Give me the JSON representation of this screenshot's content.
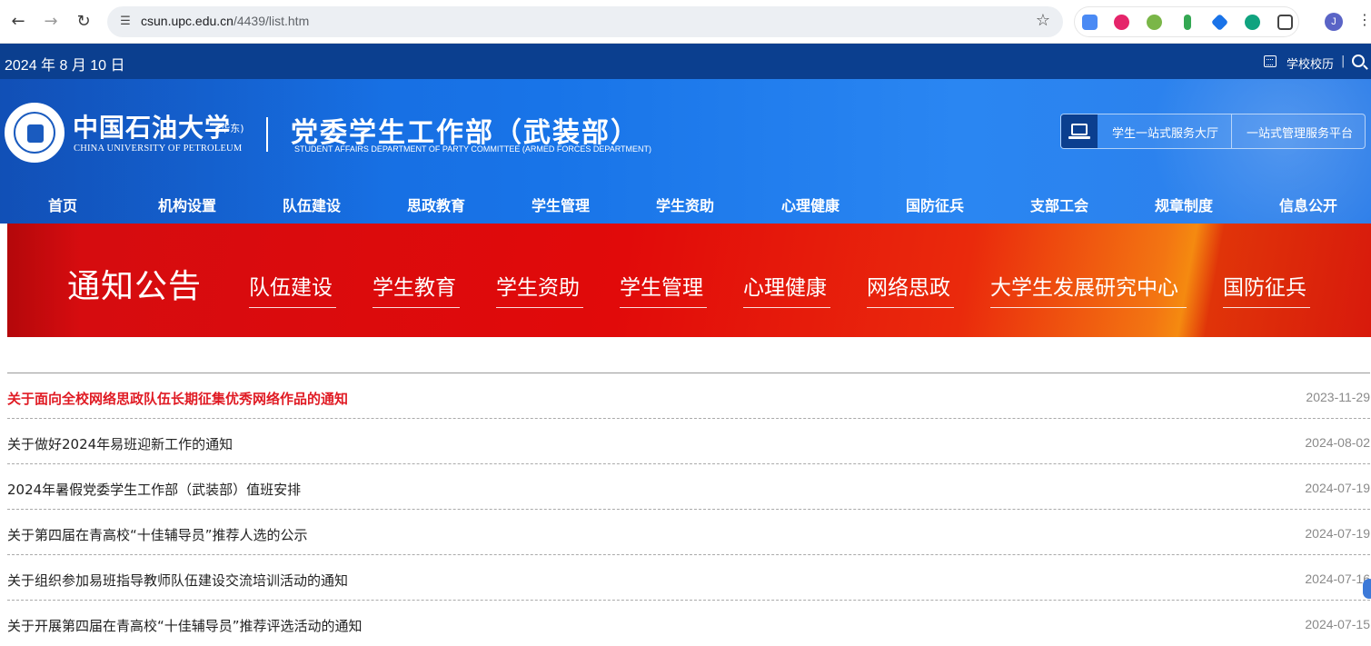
{
  "browser": {
    "url_host": "csun.upc.edu.cn",
    "url_path": "/4439/list.htm",
    "profile_initial": "J"
  },
  "topbar": {
    "date": "2024 年 8 月 10 日",
    "calendar_link": "学校校历",
    "separator": "|"
  },
  "header": {
    "university_cn": "中国石油大学",
    "university_sub": "(华东)",
    "university_en": "CHINA UNIVERSITY OF PETROLEUM",
    "department_cn": "党委学生工作部（武装部）",
    "department_en": "STUDENT AFFAIRS DEPARTMENT OF PARTY COMMITTEE (ARMED FORCES DEPARTMENT)",
    "service_links": [
      "学生一站式服务大厅",
      "一站式管理服务平台"
    ]
  },
  "main_nav": [
    "首页",
    "机构设置",
    "队伍建设",
    "思政教育",
    "学生管理",
    "学生资助",
    "心理健康",
    "国防征兵",
    "支部工会",
    "规章制度",
    "信息公开"
  ],
  "banner": {
    "title": "通知公告",
    "tabs": [
      "队伍建设",
      "学生教育",
      "学生资助",
      "学生管理",
      "心理健康",
      "网络思政",
      "大学生发展研究中心",
      "国防征兵"
    ]
  },
  "notices": [
    {
      "title": "关于面向全校网络思政队伍长期征集优秀网络作品的通知",
      "date": "2023-11-29",
      "pinned": true
    },
    {
      "title": "关于做好2024年易班迎新工作的通知",
      "date": "2024-08-02",
      "pinned": false
    },
    {
      "title": "2024年暑假党委学生工作部（武装部）值班安排",
      "date": "2024-07-19",
      "pinned": false
    },
    {
      "title": "关于第四届在青高校“十佳辅导员”推荐人选的公示",
      "date": "2024-07-19",
      "pinned": false
    },
    {
      "title": "关于组织参加易班指导教师队伍建设交流培训活动的通知",
      "date": "2024-07-16",
      "pinned": false
    },
    {
      "title": "关于开展第四届在青高校“十佳辅导员”推荐评选活动的通知",
      "date": "2024-07-15",
      "pinned": false
    }
  ],
  "colors": {
    "topbar": "#0b3f8f",
    "header_blue": "#1874e8",
    "banner_red": "#e10a0a",
    "pinned_red": "#e01b24"
  }
}
